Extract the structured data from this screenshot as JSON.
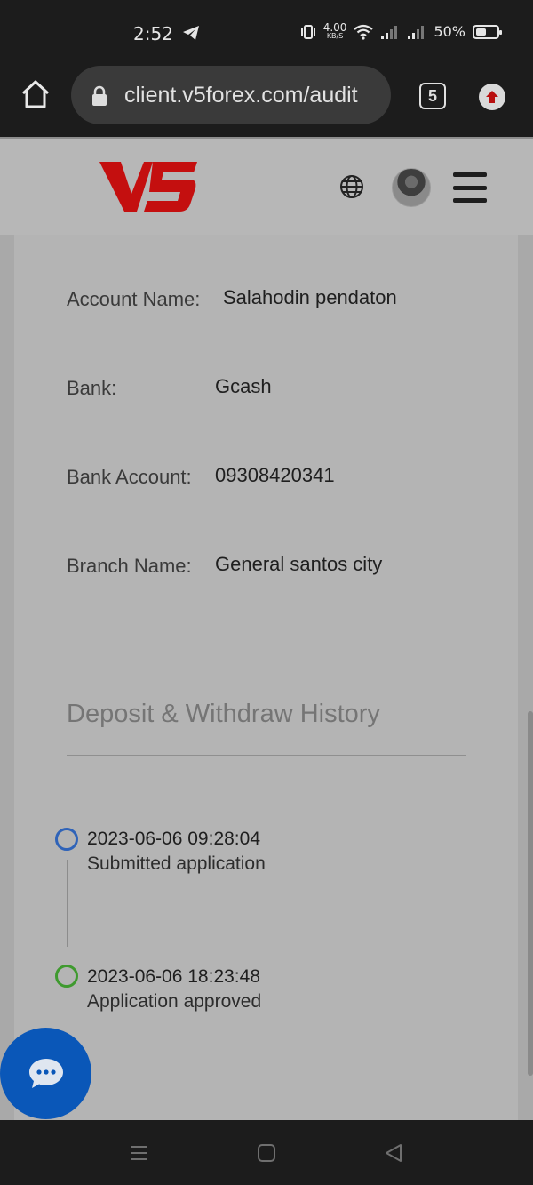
{
  "status": {
    "time": "2:52",
    "net_speed": "4.00",
    "net_unit": "KB/S",
    "battery": "50%",
    "battery_level": 0.5,
    "icons": [
      "telegram-icon",
      "vibrate-icon",
      "wifi-icon",
      "signal-icon",
      "signal-icon",
      "battery-icon"
    ]
  },
  "browser": {
    "url": "client.v5forex.com/audit",
    "tab_count": "5"
  },
  "header": {
    "logo_text": "V5",
    "colors": {
      "logo_red": "#c40f0f"
    }
  },
  "account": {
    "fields": [
      {
        "label": "Account Name:",
        "value": "Salahodin pendaton"
      },
      {
        "label": "Bank:",
        "value": "Gcash"
      },
      {
        "label": "Bank Account:",
        "value": "09308420341"
      },
      {
        "label": "Branch Name:",
        "value": "General santos city"
      }
    ]
  },
  "history": {
    "title": "Deposit & Withdraw History",
    "events": [
      {
        "time": "2023-06-06 09:28:04",
        "text": "Submitted application",
        "color": "#2f63b8"
      },
      {
        "time": "2023-06-06 18:23:48",
        "text": "Application approved",
        "color": "#3f9a2f"
      }
    ]
  },
  "chat": {
    "icon": "chat-bubble-icon",
    "color": "#0a57b8"
  }
}
